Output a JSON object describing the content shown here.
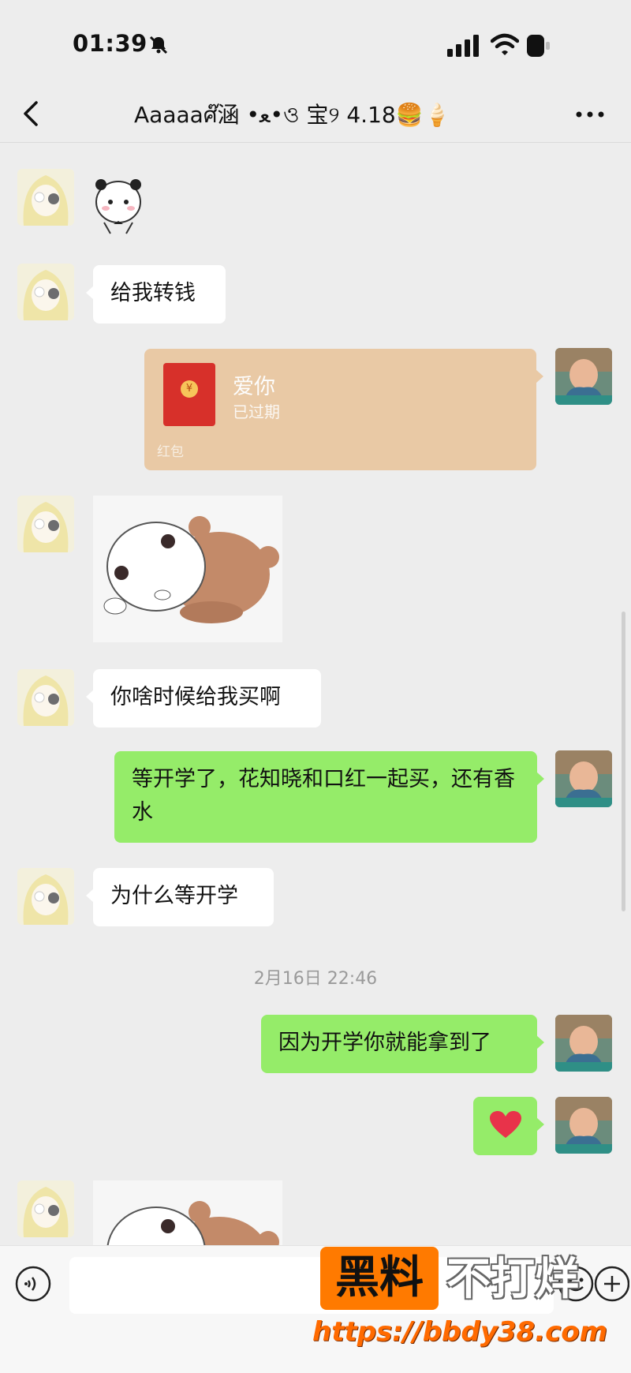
{
  "status_bar": {
    "time": "01:39"
  },
  "nav": {
    "title": "Aaaaaศ๊涵 •ﻌ•ও 宝୨ 4.18🍔🍦"
  },
  "messages": {
    "m2": "给我转钱",
    "red_packet": {
      "title": "爱你",
      "status": "已过期",
      "label": "红包",
      "coin_symbol": "¥"
    },
    "m5": "你啥时候给我买啊",
    "m6": "等开学了，花知晓和口红一起买，还有香水",
    "m7": "为什么等开学",
    "m9": "因为开学你就能拿到了",
    "m10_emoji": "❤️"
  },
  "timestamp": "2月16日 22:46",
  "input_bar": {
    "placeholder": ""
  },
  "watermark": {
    "box_text": "黑料",
    "side_text": "不打烊",
    "url": "https://bbdy38.com"
  },
  "colors": {
    "my_bubble": "#95ec69",
    "their_bubble": "#ffffff",
    "red_packet": "#e9c9a5",
    "background": "#ededed"
  }
}
